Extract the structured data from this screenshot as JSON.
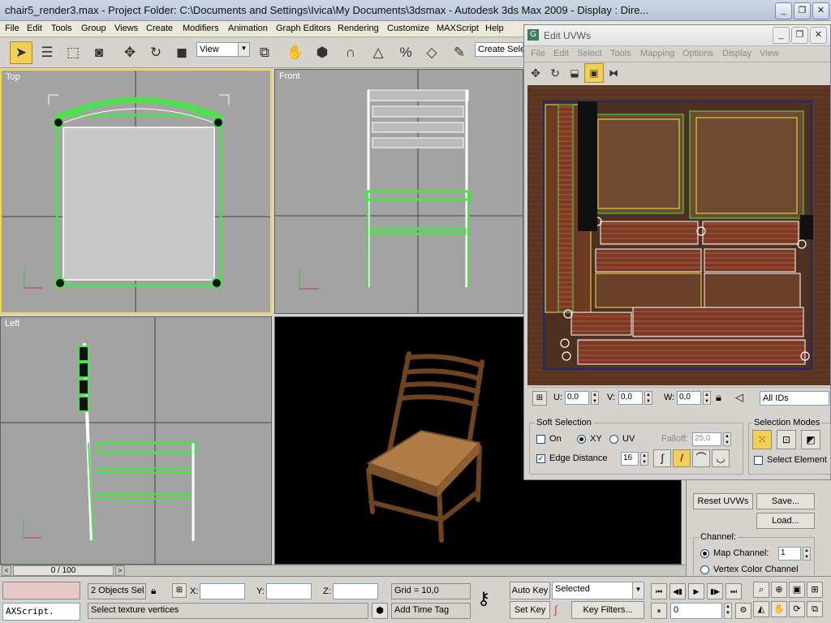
{
  "titlebar": {
    "title": "chair5_render3.max     - Project Folder: C:\\Documents and Settings\\Ivica\\My Documents\\3dsmax     - Autodesk 3ds Max  2009     - Display : Dire..."
  },
  "menubar": [
    "File",
    "Edit",
    "Tools",
    "Group",
    "Views",
    "Create",
    "Modifiers",
    "Animation",
    "Graph Editors",
    "Rendering",
    "Customize",
    "MAXScript",
    "Help"
  ],
  "toolbar": {
    "reference_coord": "View",
    "named_selection": "Create Sele"
  },
  "viewports": {
    "top": "Top",
    "front": "Front",
    "left": "Left"
  },
  "edit_uvws": {
    "title": "Edit UVWs",
    "menu": [
      "File",
      "Edit",
      "Select",
      "Tools",
      "Mapping",
      "Options",
      "Display",
      "View"
    ],
    "u_label": "U:",
    "u_value": "0,0",
    "v_label": "V:",
    "v_value": "0,0",
    "w_label": "W:",
    "w_value": "0,0",
    "ids": "All IDs",
    "soft_selection": {
      "title": "Soft Selection",
      "on": "On",
      "xy": "XY",
      "uv": "UV",
      "falloff_label": "Falloff:",
      "falloff": "25,0",
      "edge_distance": "Edge Distance",
      "edge_value": "16"
    },
    "selection_modes": {
      "title": "Selection Modes",
      "select_element": "Select Element"
    }
  },
  "command_panel": {
    "reset_uvws": "Reset UVWs",
    "save": "Save...",
    "load": "Load...",
    "channel": "Channel:",
    "map_channel": "Map Channel:",
    "map_channel_value": "1",
    "vertex_color_channel": "Vertex Color Channel"
  },
  "timeline": {
    "frame": "0 / 100"
  },
  "status": {
    "maxscript": "AXScript.",
    "objects_selected": "2 Objects Sel",
    "x_label": "X:",
    "y_label": "Y:",
    "z_label": "Z:",
    "grid": "Grid = 10,0",
    "prompt": "Select texture vertices",
    "add_time_tag": "Add Time Tag",
    "auto_key": "Auto Key",
    "set_key": "Set Key",
    "key_mode": "Selected",
    "key_filters": "Key Filters...",
    "current_frame": "0"
  },
  "colors": {
    "active_border": "#f2d84e",
    "mesh_green": "#4be34b",
    "selected_button": "#f5cf55"
  }
}
